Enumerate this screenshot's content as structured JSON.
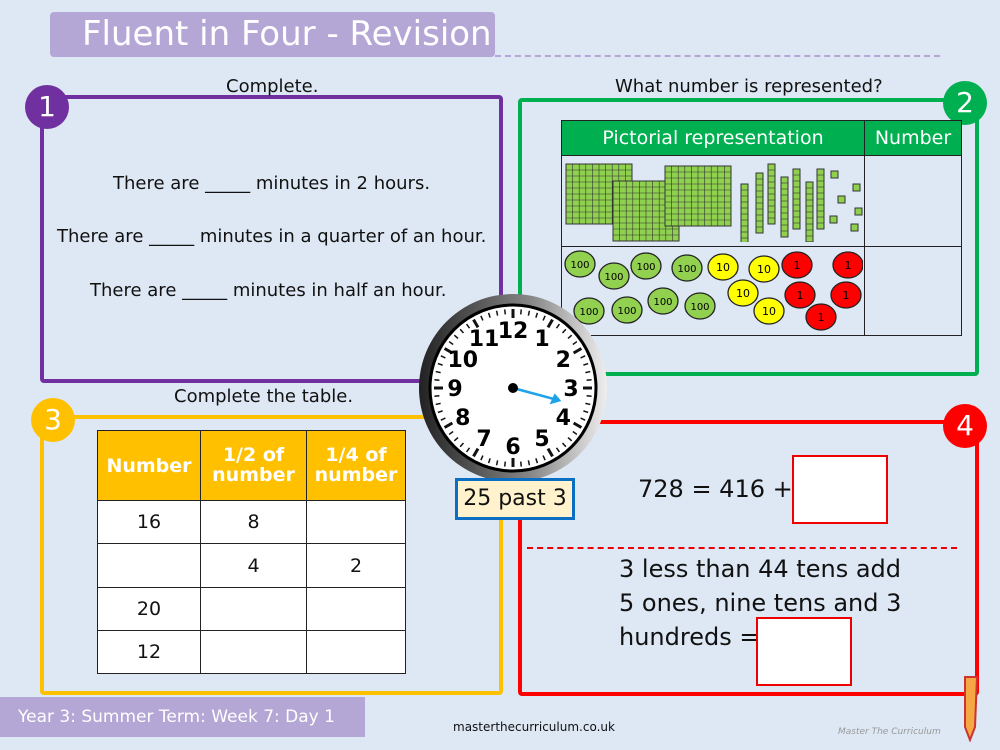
{
  "title": "Fluent in Four - Revision",
  "q1": {
    "number": "1",
    "heading": "Complete.",
    "lines": [
      "There are _____ minutes in 2 hours.",
      "There are _____ minutes in a quarter of an hour.",
      "There are _____  minutes in half an hour."
    ]
  },
  "q2": {
    "number": "2",
    "heading": "What number is represented?",
    "col_picture": "Pictorial representation",
    "col_number": "Number",
    "counters": [
      "100",
      "100",
      "100",
      "100",
      "100",
      "100",
      "100",
      "100",
      "10",
      "10",
      "10",
      "10",
      "1",
      "1",
      "1",
      "1",
      "1"
    ],
    "base10": {
      "hundreds": 3,
      "tens": 7,
      "ones": 6
    }
  },
  "q3": {
    "number": "3",
    "heading": "Complete the table.",
    "headers": [
      "Number",
      "1",
      "2",
      "of number",
      "1",
      "4",
      "of number"
    ],
    "rows": [
      [
        "16",
        "8",
        ""
      ],
      [
        "",
        "4",
        "2"
      ],
      [
        "20",
        "",
        ""
      ],
      [
        "12",
        "",
        ""
      ]
    ]
  },
  "q4": {
    "number": "4",
    "eq": "728 = 416 +",
    "word": [
      "3 less than 44 tens add",
      "5 ones, nine tens and 3",
      "hundreds ="
    ]
  },
  "clock": {
    "numbers": [
      "12",
      "1",
      "2",
      "3",
      "4",
      "5",
      "6",
      "7",
      "8",
      "9",
      "10",
      "11"
    ],
    "label": "25 past 3"
  },
  "footer": {
    "lesson": "Year 3: Summer Term: Week 7: Day 1",
    "site": "masterthecurriculum.co.uk",
    "brand": "Master The Curriculum"
  },
  "colors": {
    "q1": "#7030a0",
    "q2": "#00b050",
    "q3": "#ffc000",
    "q4": "#ff0000"
  }
}
